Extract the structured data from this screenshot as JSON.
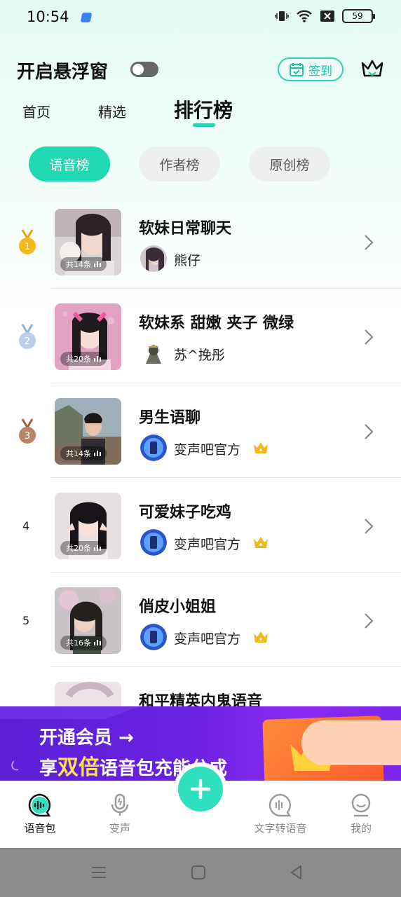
{
  "status_bar": {
    "time": "10:54",
    "battery": "59"
  },
  "header": {
    "float_window_label": "开启悬浮窗",
    "signin_label": "签到"
  },
  "tabs": [
    {
      "label": "首页"
    },
    {
      "label": "精选"
    },
    {
      "label": "排行榜"
    }
  ],
  "filters": [
    {
      "label": "语音榜"
    },
    {
      "label": "作者榜"
    },
    {
      "label": "原创榜"
    }
  ],
  "list": [
    {
      "rank": "1",
      "title": "软妹日常聊天",
      "author": "熊仔",
      "count": "共14条",
      "vip": false
    },
    {
      "rank": "2",
      "title": "软妹系 甜嫩 夹子 微绿",
      "author": "苏^挽彤",
      "count": "共20条",
      "vip": false
    },
    {
      "rank": "3",
      "title": "男生语聊",
      "author": "变声吧官方",
      "count": "共14条",
      "vip": true
    },
    {
      "rank": "4",
      "title": "可爱妹子吃鸡",
      "author": "变声吧官方",
      "count": "共20条",
      "vip": true
    },
    {
      "rank": "5",
      "title": "俏皮小姐姐",
      "author": "变声吧官方",
      "count": "共16条",
      "vip": true
    },
    {
      "rank": "",
      "title": "和平精英内鬼语音",
      "author": "",
      "count": "",
      "vip": false
    }
  ],
  "banner": {
    "line1": "开通会员 →",
    "line2_pre": "享",
    "line2_highlight": "双倍",
    "line2_post": "语音包充能分成"
  },
  "bottom_nav": [
    {
      "label": "语音包"
    },
    {
      "label": "变声"
    },
    {
      "label": "文字转语音"
    },
    {
      "label": "我的"
    }
  ],
  "colors": {
    "accent": "#1fd8b4",
    "gold": "#f5b81c",
    "silver": "#9bbbe0",
    "bronze": "#b0735a",
    "banner": "#6a21e0"
  }
}
